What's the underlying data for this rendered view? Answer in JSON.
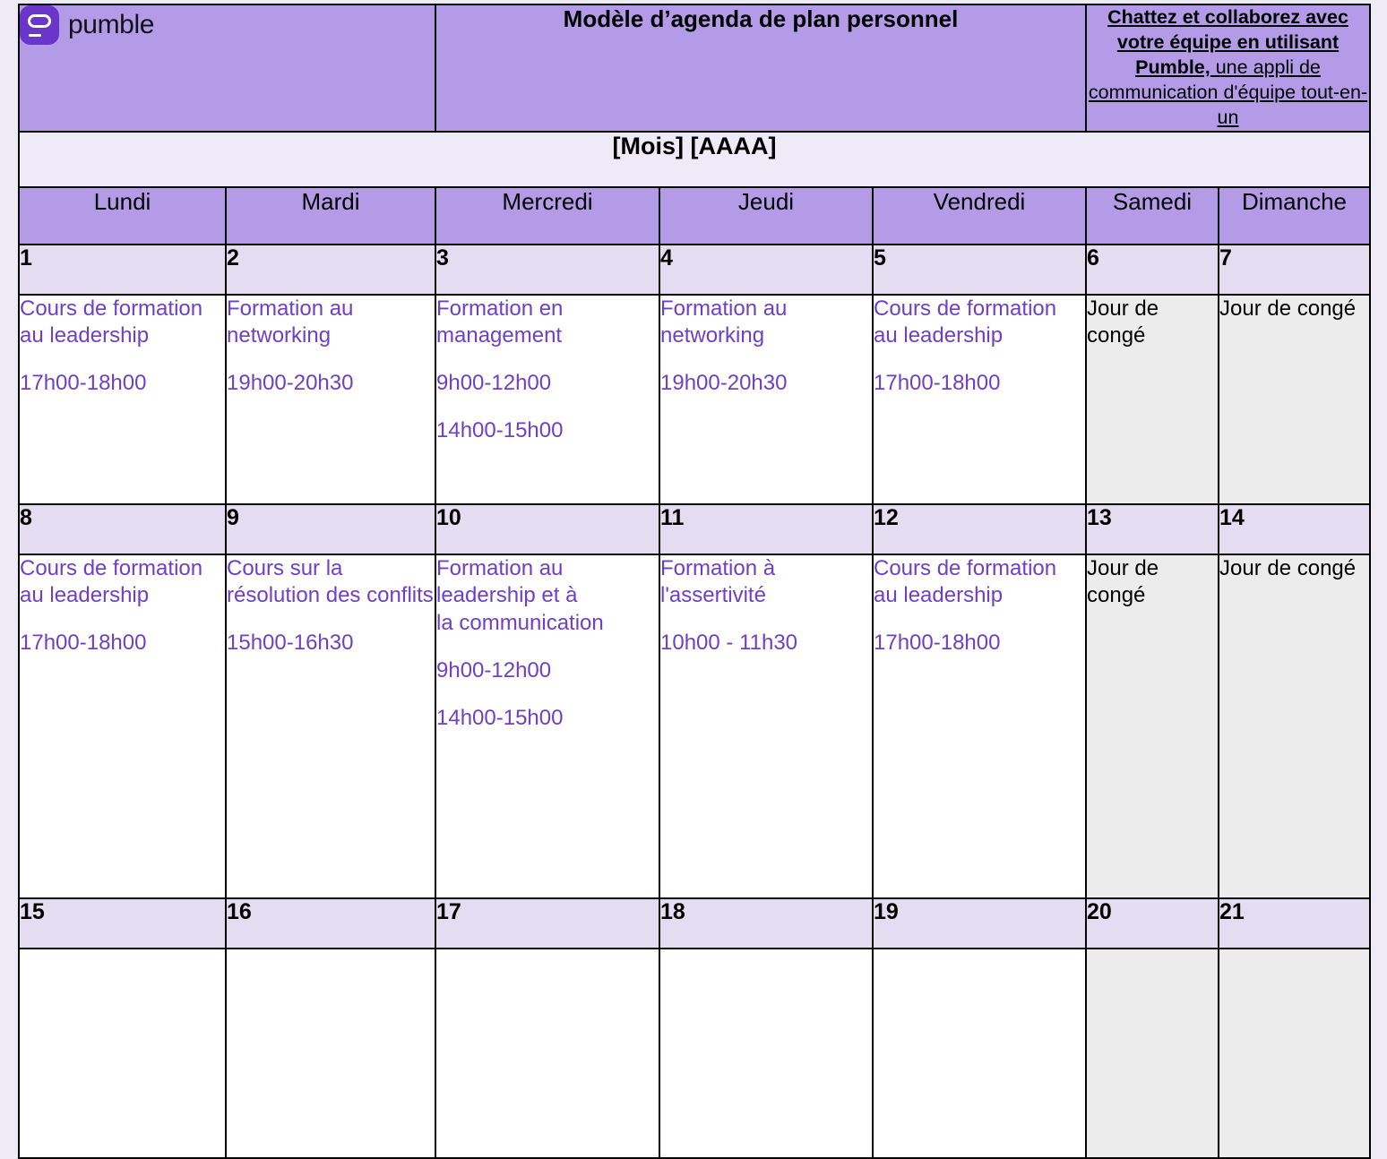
{
  "brand": {
    "logo_icon": "pumble-logo-icon",
    "wordmark": "pumble",
    "accent_purple": "#6A36C9",
    "header_purple": "#B49BE8",
    "text_purple": "#6F3FC6",
    "date_row_lavender": "#E4DCF0",
    "month_row_lavender": "#EEEAF7",
    "offday_gray": "#ECECEC"
  },
  "banner": {
    "title": "Modèle d’agenda de plan personnel",
    "cta_line1_strong": "Chattez et collaborez avec votre équipe en utilisant",
    "cta_line2_strong": "Pumble,",
    "cta_line2_normal": " une appli de communication d'équipe tout-en-un"
  },
  "month_row": {
    "label": "[Mois] [AAAA]"
  },
  "weekdays": [
    "Lundi",
    "Mardi",
    "Mercredi",
    "Jeudi",
    "Vendredi",
    "Samedi",
    "Dimanche"
  ],
  "weeks": [
    {
      "dates": [
        "1",
        "2",
        "3",
        "4",
        "5",
        "6",
        "7"
      ],
      "cells": [
        {
          "off": false,
          "title": "Cours de formation au leadership",
          "times": [
            "17h00-18h00"
          ]
        },
        {
          "off": false,
          "title": "Formation au networking",
          "times": [
            "19h00-20h30"
          ]
        },
        {
          "off": false,
          "title": "Formation en management",
          "times": [
            "9h00-12h00",
            "14h00-15h00"
          ]
        },
        {
          "off": false,
          "title": "Formation au networking",
          "times": [
            "19h00-20h30"
          ]
        },
        {
          "off": false,
          "title": "Cours de formation au leadership",
          "times": [
            "17h00-18h00"
          ]
        },
        {
          "off": true,
          "title": "Jour de congé",
          "times": []
        },
        {
          "off": true,
          "title": "Jour de congé",
          "times": []
        }
      ]
    },
    {
      "dates": [
        "8",
        "9",
        "10",
        "11",
        "12",
        "13",
        "14"
      ],
      "cells": [
        {
          "off": false,
          "title": "Cours de formation au leadership",
          "times": [
            "17h00-18h00"
          ]
        },
        {
          "off": false,
          "title": "Cours sur la résolution des conflits",
          "times": [
            "15h00-16h30"
          ]
        },
        {
          "off": false,
          "title": "Formation au leadership et à\nla communication",
          "times": [
            "9h00-12h00",
            "14h00-15h00"
          ]
        },
        {
          "off": false,
          "title": "Formation à l'assertivité",
          "times": [
            "10h00 - 11h30"
          ]
        },
        {
          "off": false,
          "title": "Cours de formation au leadership",
          "times": [
            "17h00-18h00"
          ]
        },
        {
          "off": true,
          "title": "Jour de congé",
          "times": []
        },
        {
          "off": true,
          "title": "Jour de congé",
          "times": []
        }
      ]
    },
    {
      "dates": [
        "15",
        "16",
        "17",
        "18",
        "19",
        "20",
        "21"
      ],
      "cells": [
        {
          "off": false,
          "title": "",
          "times": []
        },
        {
          "off": false,
          "title": "",
          "times": []
        },
        {
          "off": false,
          "title": "",
          "times": []
        },
        {
          "off": false,
          "title": "",
          "times": []
        },
        {
          "off": false,
          "title": "",
          "times": []
        },
        {
          "off": true,
          "title": "",
          "times": []
        },
        {
          "off": true,
          "title": "",
          "times": []
        }
      ]
    }
  ]
}
